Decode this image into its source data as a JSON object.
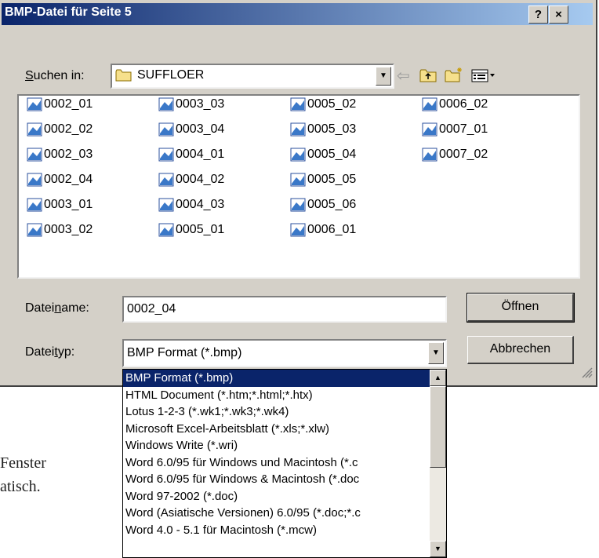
{
  "title": "BMP-Datei für Seite 5",
  "title_buttons": {
    "help": "?",
    "close": "×"
  },
  "lookin": {
    "label": "Suchen in:",
    "value": "SUFFLOER"
  },
  "toolbar": {
    "back": "⇦",
    "up": "up-folder-icon",
    "new_folder": "new-folder-icon",
    "view_menu": "view-menu-icon"
  },
  "files": [
    [
      "0002_01",
      "0002_02",
      "0002_03",
      "0002_04",
      "0003_01",
      "0003_02"
    ],
    [
      "0003_03",
      "0003_04",
      "0004_01",
      "0004_02",
      "0004_03",
      "0005_01"
    ],
    [
      "0005_02",
      "0005_03",
      "0005_04",
      "0005_05",
      "0005_06",
      "0006_01"
    ],
    [
      "0006_02",
      "0007_01",
      "0007_02"
    ]
  ],
  "filename": {
    "label": "Dateiname:",
    "value": "0002_04"
  },
  "filetype": {
    "label": "Dateityp:",
    "value": "BMP Format (*.bmp)"
  },
  "buttons": {
    "open": "Öffnen",
    "cancel": "Abbrechen"
  },
  "filetype_options": [
    "BMP Format (*.bmp)",
    "HTML Document (*.htm;*.html;*.htx)",
    "Lotus 1-2-3 (*.wk1;*.wk3;*.wk4)",
    "Microsoft Excel-Arbeitsblatt (*.xls;*.xlw)",
    "Windows Write (*.wri)",
    "Word 6.0/95 für Windows und Macintosh (*.c",
    "Word 6.0/95 für Windows & Macintosh (*.doc",
    "Word 97-2002 (*.doc)",
    "Word (Asiatische Versionen) 6.0/95 (*.doc;*.c",
    "Word 4.0 - 5.1 für Macintosh (*.mcw)"
  ],
  "background_text": [
    "Fenster",
    "atisch."
  ],
  "colors": {
    "title_start": "#0a246a",
    "title_end": "#a6caf0",
    "selection": "#0a246a",
    "face": "#d4d0c8"
  }
}
